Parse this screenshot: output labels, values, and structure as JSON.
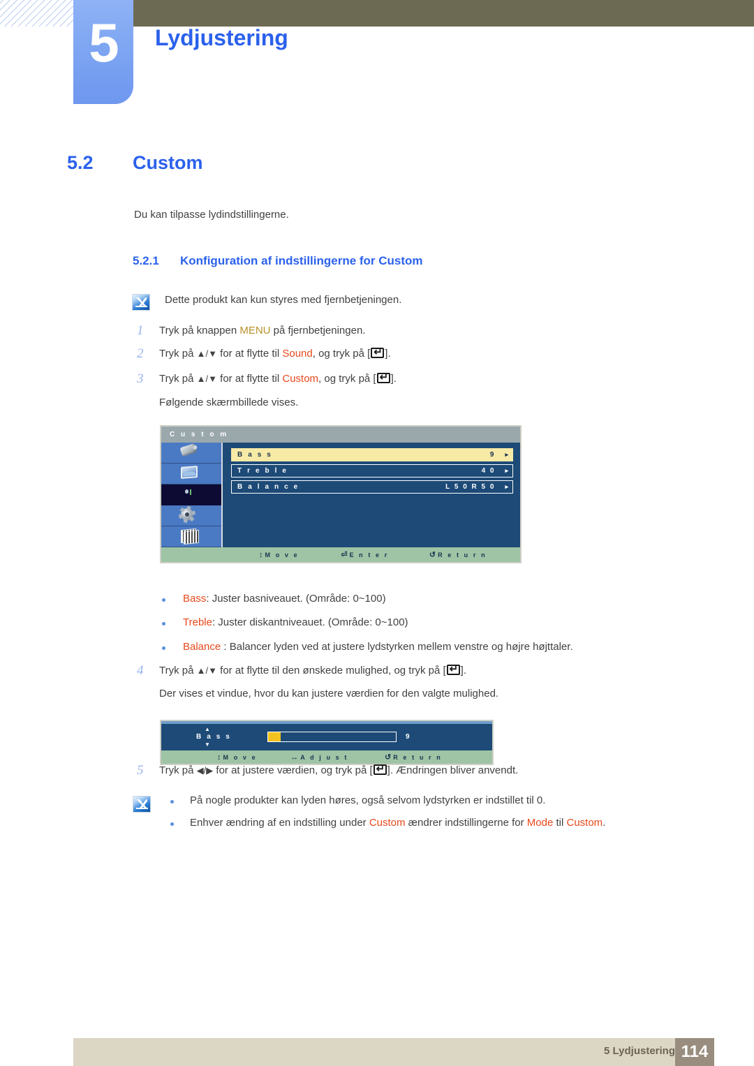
{
  "header": {
    "chapter_number": "5",
    "chapter_title": "Lydjustering",
    "olive_bar_color": "#6d6a54",
    "tab_color": "#7ea6f2",
    "accent_color": "#2b61ec"
  },
  "section": {
    "number": "5.2",
    "title": "Custom",
    "intro": "Du kan tilpasse lydindstillingerne.",
    "subsection_number": "5.2.1",
    "subsection_title": "Konfiguration af indstillingerne for Custom"
  },
  "note_top": {
    "icon": "note-pen-icon",
    "text": "Dette produkt kan kun styres med fjernbetjeningen."
  },
  "steps": [
    {
      "num": "1",
      "parts": [
        {
          "t": "Tryk på knappen ",
          "k": "plain"
        },
        {
          "t": "MENU",
          "k": "menu"
        },
        {
          "t": " på fjernbetjeningen.",
          "k": "plain"
        }
      ]
    },
    {
      "num": "2",
      "parts": [
        {
          "t": "Tryk på ",
          "k": "plain"
        },
        {
          "t": "▲/▼",
          "k": "arrows"
        },
        {
          "t": " for at flytte til ",
          "k": "plain"
        },
        {
          "t": "Sound",
          "k": "red"
        },
        {
          "t": ", og tryk på [",
          "k": "plain"
        },
        {
          "t": "enter-key",
          "k": "key"
        },
        {
          "t": "].",
          "k": "plain"
        }
      ]
    },
    {
      "num": "3",
      "parts": [
        {
          "t": "Tryk på ",
          "k": "plain"
        },
        {
          "t": "▲/▼",
          "k": "arrows"
        },
        {
          "t": " for at flytte til ",
          "k": "plain"
        },
        {
          "t": "Custom",
          "k": "red"
        },
        {
          "t": ", og tryk på [",
          "k": "plain"
        },
        {
          "t": "enter-key",
          "k": "key"
        },
        {
          "t": "].",
          "k": "plain"
        }
      ]
    }
  ],
  "after_step3": "Følgende skærmbillede vises.",
  "osd_menu": {
    "title": "C u s t o m",
    "sidebar_icons": [
      "projector-icon",
      "picture-icon",
      "sound-icon",
      "gear-icon",
      "layers-icon"
    ],
    "selected_sidebar_index": 2,
    "rows": [
      {
        "label": "B a s s",
        "value": "9",
        "chevron": "▸",
        "state": "active"
      },
      {
        "label": "T r e b l e",
        "value": "4 0",
        "chevron": "▸",
        "state": "normal"
      },
      {
        "label": "B a l a n c e",
        "value": "L  5 0   R  5 0",
        "chevron": "▸",
        "state": "normal"
      }
    ],
    "footer": [
      {
        "glyph": "↕",
        "label": "M o v e"
      },
      {
        "glyph": "⏎",
        "label": "E n t e r"
      },
      {
        "glyph": "↺",
        "label": "R e t u r n"
      }
    ],
    "colors": {
      "background": "#1d4a77",
      "titlebar": "#9aa8ac",
      "sidebar": "#4b7ac4",
      "selected": "#0d0b33",
      "highlight": "#f6eaa6",
      "footer": "#9ec4a5"
    }
  },
  "bullets": [
    [
      {
        "t": "Bass",
        "k": "red"
      },
      {
        "t": ": Juster basniveauet. (Område: 0~100)",
        "k": "plain"
      }
    ],
    [
      {
        "t": "Treble",
        "k": "red"
      },
      {
        "t": ": Juster diskantniveauet. (Område: 0~100)",
        "k": "plain"
      }
    ],
    [
      {
        "t": "Balance",
        "k": "red"
      },
      {
        "t": " : Balancer lyden ved at justere lydstyrken mellem venstre og højre højttaler.",
        "k": "plain"
      }
    ]
  ],
  "step4": {
    "num": "4",
    "parts": [
      {
        "t": "Tryk på ",
        "k": "plain"
      },
      {
        "t": "▲/▼",
        "k": "arrows"
      },
      {
        "t": " for at flytte til den ønskede mulighed, og tryk på [",
        "k": "plain"
      },
      {
        "t": "enter-key",
        "k": "key"
      },
      {
        "t": "].",
        "k": "plain"
      }
    ],
    "followup": "Der vises et vindue, hvor du kan justere værdien for den valgte mulighed."
  },
  "osd_adjust": {
    "label": "B a s s",
    "value": "9",
    "fill_percent": 9,
    "up_arrow": "▲",
    "down_arrow": "▼",
    "footer": [
      {
        "glyph": "↕",
        "label": "M o v e"
      },
      {
        "glyph": "↔",
        "label": "A d j u s t"
      },
      {
        "glyph": "↺",
        "label": "R e t u r n"
      }
    ],
    "fill_color": "#f2c320"
  },
  "step5": {
    "num": "5",
    "parts": [
      {
        "t": "Tryk på ",
        "k": "plain"
      },
      {
        "t": "◀/▶",
        "k": "arrows"
      },
      {
        "t": " for at justere værdien, og tryk på [",
        "k": "plain"
      },
      {
        "t": "enter-key",
        "k": "key"
      },
      {
        "t": "]. Ændringen bliver anvendt.",
        "k": "plain"
      }
    ]
  },
  "note_bottom": {
    "icon": "note-pen-icon",
    "items": [
      [
        {
          "t": "På nogle produkter kan lyden høres, også selvom lydstyrken er indstillet til 0.",
          "k": "plain"
        }
      ],
      [
        {
          "t": "Enhver ændring af en indstilling under ",
          "k": "plain"
        },
        {
          "t": "Custom",
          "k": "red"
        },
        {
          "t": " ændrer indstillingerne for ",
          "k": "plain"
        },
        {
          "t": "Mode",
          "k": "red"
        },
        {
          "t": " til ",
          "k": "plain"
        },
        {
          "t": "Custom",
          "k": "red"
        },
        {
          "t": ".",
          "k": "plain"
        }
      ]
    ]
  },
  "footer": {
    "text": "5 Lydjustering",
    "page": "114",
    "bar_color": "#dcd6c4",
    "page_box_color": "#988d7e"
  }
}
